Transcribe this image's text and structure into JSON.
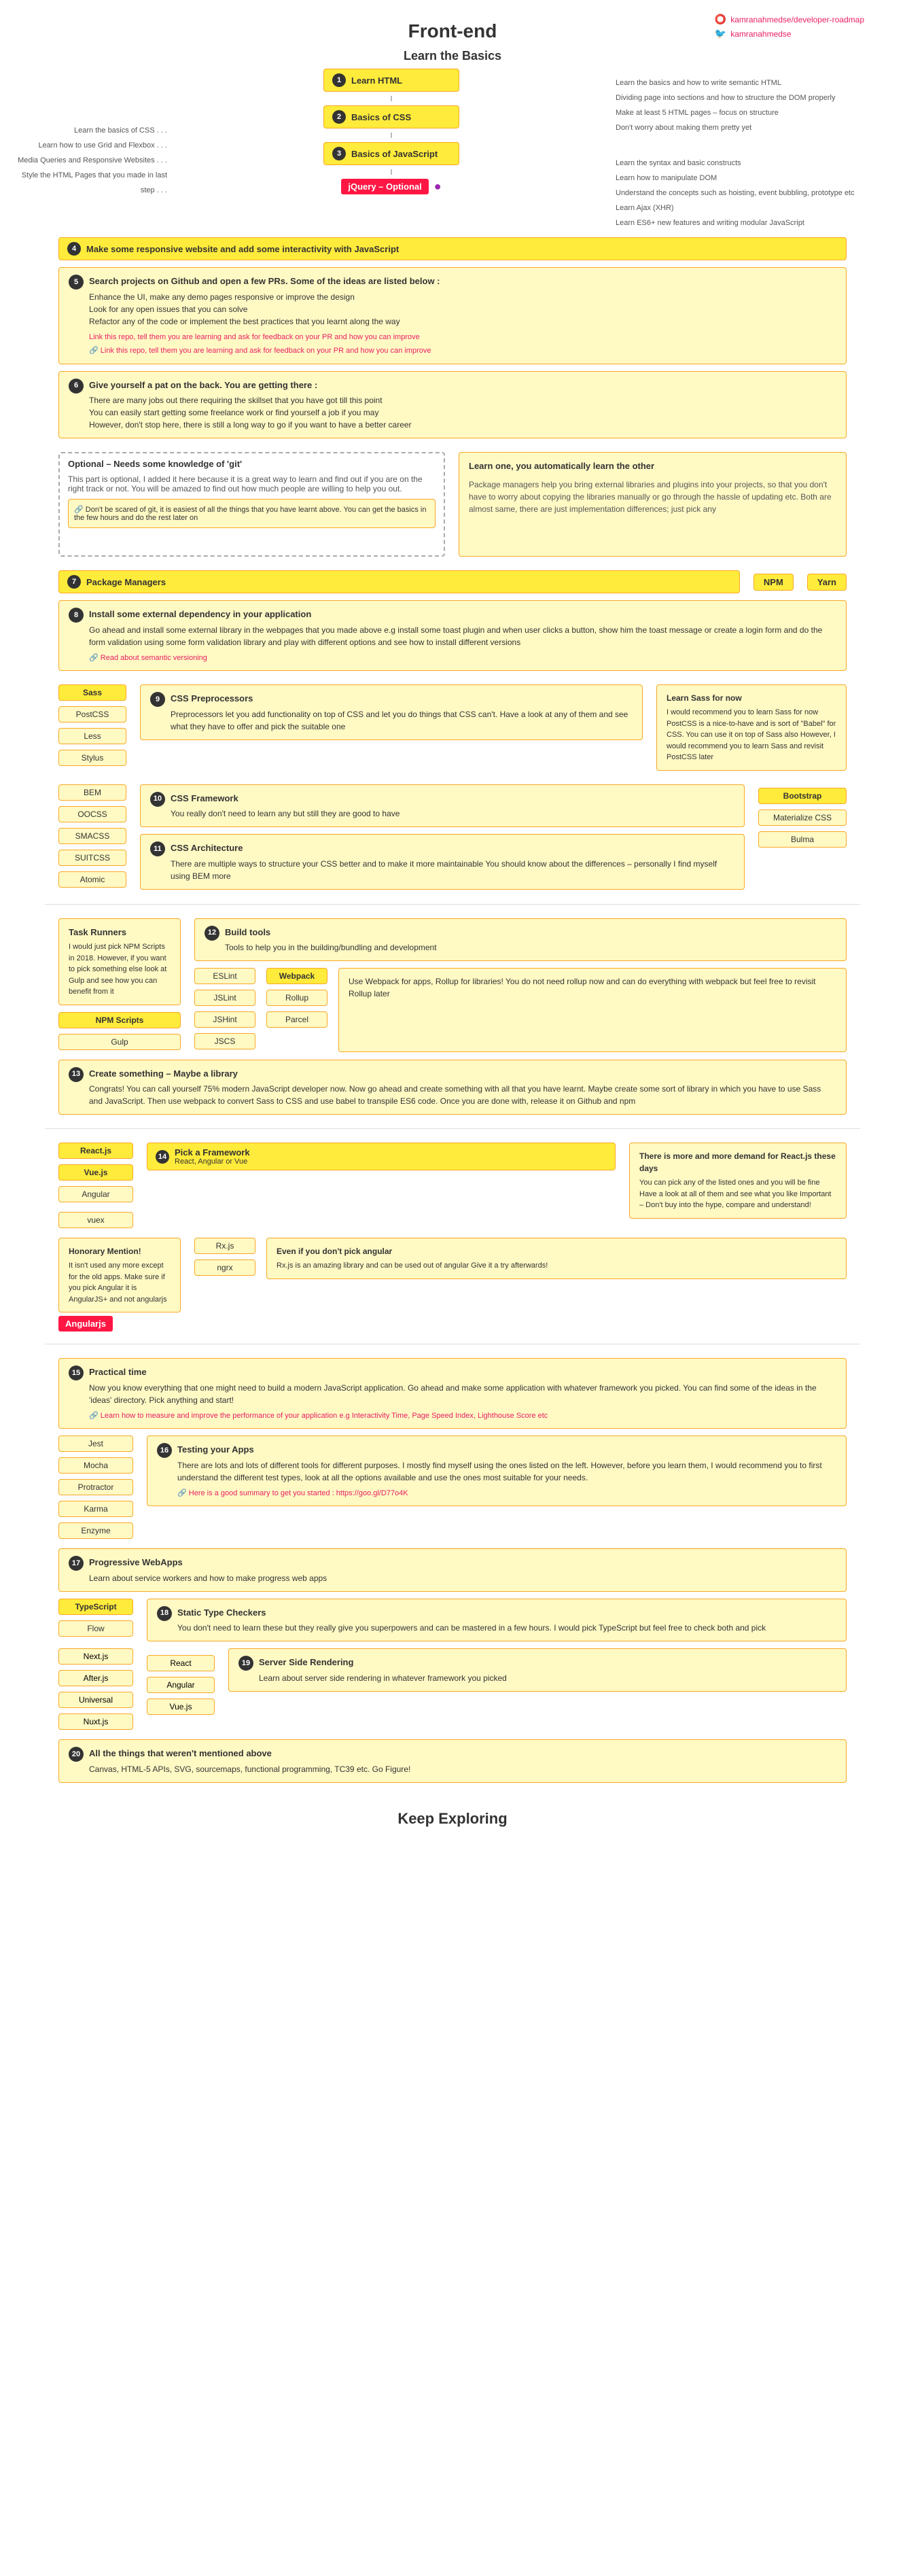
{
  "header": {
    "title": "Front-end",
    "github_text": "kamranahmedse/developer-roadmap",
    "twitter_text": "kamranahmedse"
  },
  "section1": {
    "title": "Learn the Basics",
    "left_hints": [
      "Learn the basics of CSS ..",
      "Learn how to use Grid and Flexbox ..",
      "Media Queries and Responsive Websites ..",
      "Style the HTML Pages that you made in last step .."
    ],
    "right_hints": [
      "Learn the basics and how to write semantic HTML",
      "Dividing page into sections and how to structure the DOM properly",
      "Make at least 5 HTML pages – focus on structure",
      "Don't worry about making them pretty yet"
    ],
    "steps": [
      {
        "num": "1",
        "label": "Learn HTML"
      },
      {
        "num": "2",
        "label": "Basics of CSS"
      },
      {
        "num": "3",
        "label": "Basics of JavaScript"
      }
    ],
    "js_hints": [
      "Learn the syntax and basic constructs",
      "Learn how to manipulate DOM",
      "Understand the concepts such as hoisting, event bubbling, prototype etc",
      "Learn Ajax (XHR)",
      "Learn ES6+ new features and writing modular JavaScript"
    ],
    "optional_label": "jQuery – Optional"
  },
  "section2": {
    "step4_label": "Make some responsive website and add some interactivity with JavaScript",
    "step4_num": "4"
  },
  "section3": {
    "step5_num": "5",
    "step5_label": "Search projects on Github and open a few PRs. Some of the ideas are listed below :",
    "step5_items": [
      "Enhance the UI, make any demo pages responsive or improve the design",
      "Look for any open issues that you can solve",
      "Refactor any of the code or implement the best practices that you learnt along the way"
    ],
    "step5_link": "Link this repo, tell them you are learning and ask for feedback on your PR and how you can improve"
  },
  "section4": {
    "step6_num": "6",
    "step6_label": "Give yourself a pat on the back. You are getting there :",
    "step6_items": [
      "There are many jobs out there requiring the skillset that you have got till this point",
      "You can easily start getting some freelance work or find yourself a job if you may",
      "However, don't stop here, there is still a long way to go if you want to have a better career"
    ]
  },
  "section5": {
    "optional_title": "Optional – Needs some knowledge of 'git'",
    "optional_body": "This part is optional, I added it here because it is a great way to learn and find out if you are on the right track or not. You will be amazed to find out how much people are willing to help you out.",
    "optional_note": "Don't be scared of git, it is easiest of all the things that you have learnt above. You can get the basics in the few hours and do the rest later on",
    "other_title": "Learn one, you automatically learn the other",
    "other_body": "Package managers help you bring external libraries and plugins into your projects, so that you don't have to worry about copying the libraries manually or go through the hassle of updating etc. Both are almost same, there are just implementation differences; just pick any"
  },
  "section6": {
    "step7_num": "7",
    "step7_label": "Package Managers",
    "npm_label": "NPM",
    "yarn_label": "Yarn"
  },
  "section7": {
    "step8_num": "8",
    "step8_label": "Install some external dependency in your application",
    "step8_body": "Go ahead and install some external library in the webpages that you made above e.g install some toast plugin and when user clicks a button, show him the toast message or create a login form and do the form validation using some form validation library and play with different options and see how to install different versions",
    "step8_link": "Read about semantic versioning"
  },
  "section8": {
    "sass_label": "Sass",
    "postcss_label": "PostCSS",
    "less_label": "Less",
    "stylus_label": "Stylus",
    "step9_num": "9",
    "step9_label": "CSS Preprocessors",
    "step9_body": "Preprocessors let you add functionality on top of CSS and let you do things that CSS can't. Have a look at any of them and see what they have to offer and pick the suitable one",
    "sass_note_title": "Learn Sass for now",
    "sass_note_body": "I would recommend you to learn Sass for now PostCSS is a nice-to-have and is sort of \"Babel\" for CSS. You can use it on top of Sass also However, I would recommend you to learn Sass and revisit PostCSS later"
  },
  "section9": {
    "bem_label": "BEM",
    "oocss_label": "OOCSS",
    "smacss_label": "SMACSS",
    "suitcss_label": "SUITCSS",
    "atomic_label": "Atomic",
    "step10_num": "10",
    "step10_label": "CSS Framework",
    "step10_body": "You really don't need to learn any but still they are good to have",
    "bootstrap_label": "Bootstrap",
    "materialize_label": "Materialize CSS",
    "bulma_label": "Bulma",
    "step11_num": "11",
    "step11_label": "CSS Architecture",
    "step11_body": "There are multiple ways to structure your CSS better and to make it more maintainable You should know about the differences – personally I find myself using BEM more"
  },
  "section10": {
    "task_runners_title": "Task Runners",
    "task_runners_body": "I would just pick NPM Scripts in 2018. However, if you want to pick something else look at Gulp and see how you can benefit from it",
    "npm_scripts_label": "NPM Scripts",
    "gulp_label": "Gulp",
    "step12_num": "12",
    "step12_label": "Build tools",
    "step12_body": "Tools to help you in the building/bundling and development",
    "linters": [
      "ESLint",
      "JSLint",
      "JSHint",
      "JSCS"
    ],
    "bundlers": [
      "Webpack",
      "Rollup",
      "Parcel"
    ],
    "webpack_note": "Use Webpack for apps, Rollup for libraries! You do not need rollup now and can do everything with webpack but feel free to revisit Rollup later"
  },
  "section11": {
    "step13_num": "13",
    "step13_label": "Create something – Maybe a library",
    "step13_body": "Congrats! You can call yourself 75% modern JavaScript developer now. Now go ahead and create something with all that you have learnt. Maybe create some sort of library in which you have to use Sass and JavaScript. Then use webpack to convert Sass to CSS and use babel to transpile ES6 code. Once you are done with, release it on Github and npm"
  },
  "section12": {
    "reactjs_label": "React.js",
    "vuejs_label": "Vue.js",
    "angular_label": "Angular",
    "vuex_label": "vuex",
    "step14_num": "14",
    "step14_label": "Pick a Framework",
    "step14_sublabel": "React, Angular or Vue",
    "react_note_title": "There is more and more demand for React.js these days",
    "react_note_body": "You can pick any of the listed ones and you will be fine Have a look at all of them and see what you like Important – Don't buy into the hype, compare and understand!"
  },
  "section13": {
    "angularjs_badge": "Angularjs",
    "note_title": "Even if you don't pick angular",
    "note_body": "Rx.js is an amazing library and can be used out of angular Give it a try afterwards!",
    "rxjs_label": "Rx.js",
    "ngrx_label": "ngrx",
    "honorary_title": "Honorary Mention!",
    "honorary_body": "It isn't used any more except for the old apps. Make sure if you pick Angular it is AngularJS+ and not angularjs"
  },
  "section14": {
    "step15_num": "15",
    "step15_label": "Practical time",
    "step15_body": "Now you know everything that one might need to build a modern JavaScript application. Go ahead and make some application with whatever framework you picked. You can find some of the ideas in the 'ideas' directory. Pick anything and start!",
    "step15_link": "Learn how to measure and improve the performance of your application e.g Interactivity Time, Page Speed Index, Lighthouse Score etc"
  },
  "section15": {
    "step16_num": "16",
    "step16_label": "Testing your Apps",
    "step16_body": "There are lots and lots of different tools for different purposes. I mostly find myself using the ones listed on the left. However, before you learn them, I would recommend you to first understand the different test types, look at all the options available and use the ones most suitable for your needs.",
    "step16_link": "Here is a good summary to get you started : https://goo.gl/D77o4K",
    "test_items": [
      "Jest",
      "Mocha",
      "Protractor",
      "Karma",
      "Enzyme"
    ]
  },
  "section16": {
    "step17_num": "17",
    "step17_label": "Progressive WebApps",
    "step17_body": "Learn about service workers and how to make progress web apps"
  },
  "section17": {
    "step18_num": "18",
    "step18_label": "Static Type Checkers",
    "step18_body": "You don't need to learn these but they really give you superpowers and can be mastered in a few hours. I would pick TypeScript but feel free to check both and pick",
    "ts_label": "TypeScript",
    "flow_label": "Flow"
  },
  "section18": {
    "step19_num": "19",
    "step19_label": "Server Side Rendering",
    "step19_body": "Learn about server side rendering in whatever framework you picked",
    "ssr_items_left": [
      "Next.js",
      "After.js",
      "Universal",
      "Nuxt.js"
    ],
    "ssr_items_mid": [
      "React",
      "Angular",
      "Vue.js"
    ]
  },
  "section19": {
    "step20_num": "20",
    "step20_label": "All the things that weren't mentioned above",
    "step20_body": "Canvas, HTML-5 APIs, SVG, sourcemaps, functional programming, TC39 etc. Go Figure!"
  },
  "footer": {
    "label": "Keep Exploring"
  }
}
